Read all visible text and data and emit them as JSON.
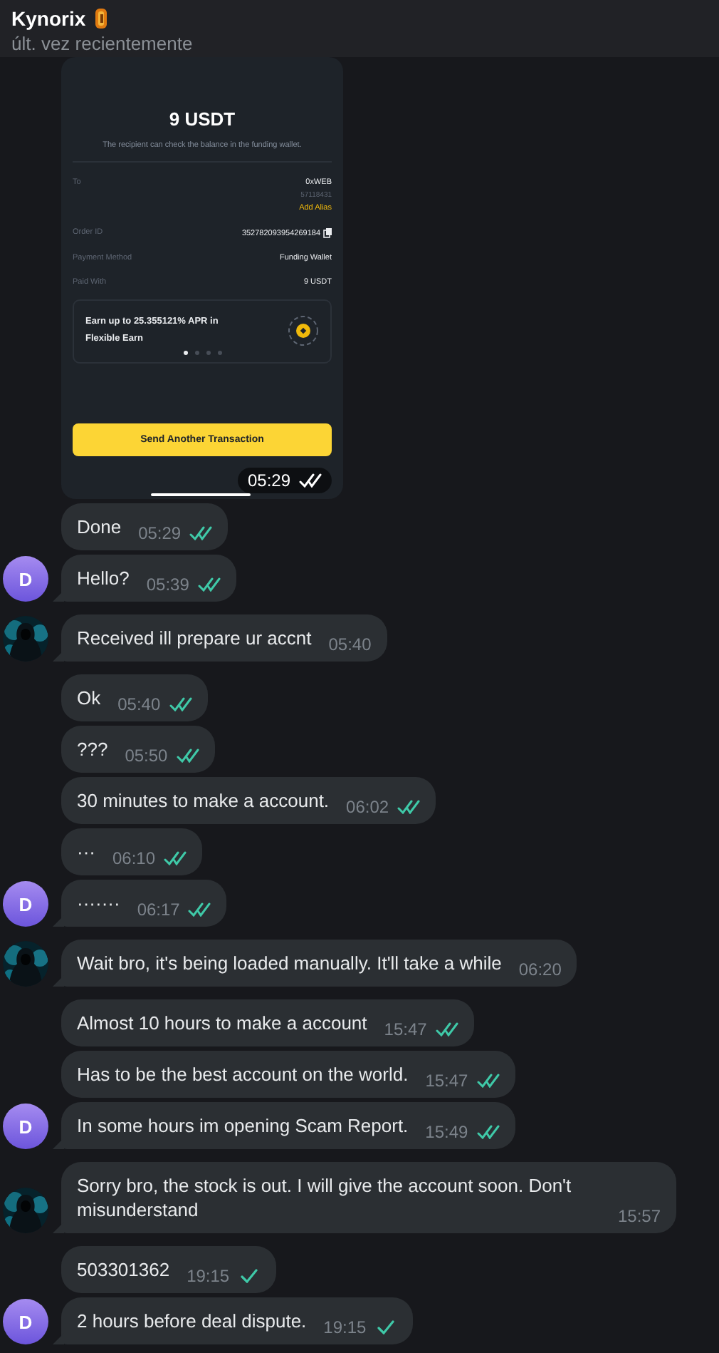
{
  "header": {
    "name": "Kynorix",
    "status": "últ. vez recientemente"
  },
  "messages": [
    {
      "kind": "receipt",
      "outgoing": true,
      "receipt": {
        "amount": "9 USDT",
        "note": "The recipient can check the balance in the funding wallet.",
        "rows": [
          {
            "label": "To",
            "value": "0xWEB",
            "sub": "57118431",
            "link": "Add Alias"
          },
          {
            "label": "Order ID",
            "value": "352782093954269184",
            "copy": true
          },
          {
            "label": "Payment Method",
            "value": "Funding Wallet"
          },
          {
            "label": "Paid With",
            "value": "9 USDT"
          }
        ],
        "promo": "Earn up to 25.355121% APR in Flexible Earn",
        "dots": [
          {
            "selected": true
          },
          {
            "selected": false
          },
          {
            "selected": false
          },
          {
            "selected": false
          }
        ],
        "button": "Send Another Transaction"
      },
      "time": "05:29",
      "read": true
    },
    {
      "kind": "text",
      "outgoing": true,
      "text": "Done",
      "time": "05:29",
      "read": true
    },
    {
      "kind": "text",
      "outgoing": true,
      "text": "Hello?",
      "time": "05:39",
      "read": true,
      "avatar": {
        "kind": "initial",
        "text": "D"
      }
    },
    {
      "kind": "text",
      "outgoing": false,
      "text": "Received ill prepare ur accnt",
      "time": "05:40"
    },
    {
      "kind": "text",
      "outgoing": true,
      "text": "Ok",
      "time": "05:40",
      "read": true
    },
    {
      "kind": "text",
      "outgoing": true,
      "text": "???",
      "time": "05:50",
      "read": true
    },
    {
      "kind": "text",
      "outgoing": true,
      "text": "30 minutes to make a account.",
      "time": "06:02",
      "read": true
    },
    {
      "kind": "text",
      "outgoing": true,
      "text": "···",
      "time": "06:10",
      "read": true
    },
    {
      "kind": "text",
      "outgoing": true,
      "text": "·······",
      "time": "06:17",
      "read": true,
      "avatar": {
        "kind": "initial",
        "text": "D"
      }
    },
    {
      "kind": "text",
      "outgoing": false,
      "text": "Wait bro, it's being loaded manually. It'll take a while",
      "time": "06:20"
    },
    {
      "kind": "text",
      "outgoing": true,
      "text": "Almost 10 hours to make a account",
      "time": "15:47",
      "read": true
    },
    {
      "kind": "text",
      "outgoing": true,
      "text": "Has to be the best account on the world.",
      "time": "15:47",
      "read": true
    },
    {
      "kind": "text",
      "outgoing": true,
      "text": "In some hours im opening Scam Report.",
      "time": "15:49",
      "read": true,
      "avatar": {
        "kind": "initial",
        "text": "D"
      }
    },
    {
      "kind": "text",
      "outgoing": false,
      "text": "Sorry bro, the stock is out. I will give the account soon. Don't misunderstand",
      "time": "15:57"
    },
    {
      "kind": "text",
      "outgoing": true,
      "text": "503301362",
      "time": "19:15",
      "read": false
    },
    {
      "kind": "text",
      "outgoing": true,
      "text": "2 hours before deal dispute.",
      "time": "19:15",
      "read": false,
      "avatar": {
        "kind": "initial",
        "text": "D"
      }
    }
  ]
}
